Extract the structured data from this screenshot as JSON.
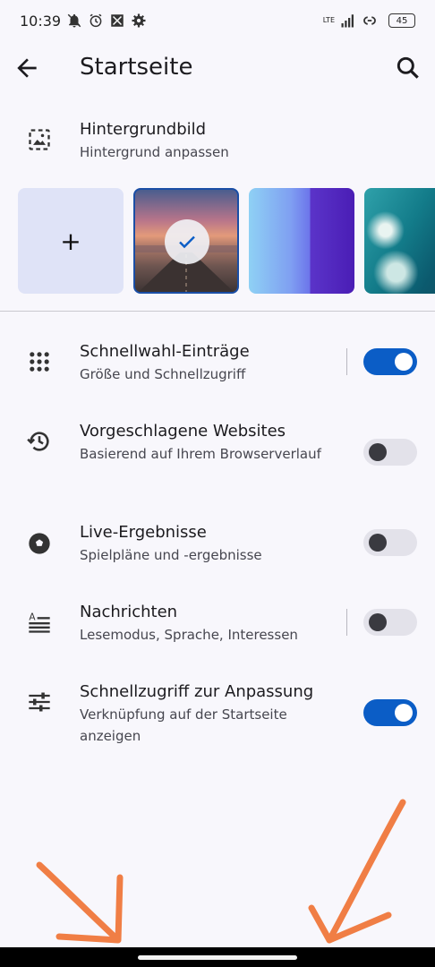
{
  "status_bar": {
    "time": "10:39",
    "network": "LTE",
    "battery": "45",
    "icons": [
      "bell-off-icon",
      "alarm-icon",
      "screen-icon",
      "gear-icon",
      "signal-icon",
      "link-icon",
      "battery-icon"
    ]
  },
  "appbar": {
    "title": "Startseite",
    "back_icon": "arrow-back-icon",
    "search_icon": "search-icon"
  },
  "wallpaper_section": {
    "title": "Hintergrundbild",
    "subtitle": "Hintergrund anpassen",
    "add_label": "+",
    "items": [
      {
        "name": "add",
        "selected": false
      },
      {
        "name": "road-sunset",
        "selected": true
      },
      {
        "name": "blue-purple-gradient",
        "selected": false
      },
      {
        "name": "ocean-waves",
        "selected": false
      }
    ]
  },
  "settings": [
    {
      "title": "Schnellwahl-Einträge",
      "subtitle": "Größe und Schnellzugriff",
      "icon": "grid-dots-icon",
      "enabled": true
    },
    {
      "title": "Vorgeschlagene Websites",
      "subtitle": "Basierend auf Ihrem Browserverlauf",
      "icon": "history-icon",
      "enabled": false
    },
    {
      "title": "Live-Ergebnisse",
      "subtitle": "Spielpläne und -ergebnisse",
      "icon": "soccer-ball-icon",
      "enabled": false
    },
    {
      "title": "Nachrichten",
      "subtitle": "Lesemodus, Sprache, Interessen",
      "icon": "article-icon",
      "enabled": false
    },
    {
      "title": "Schnellzugriff zur Anpassung",
      "subtitle": "Verknüpfung auf der Startseite anzeigen",
      "icon": "tune-icon",
      "enabled": true
    }
  ],
  "colors": {
    "accent": "#0b5dc6",
    "annotation_arrow": "#f07e45",
    "background": "#f8f7fc"
  }
}
